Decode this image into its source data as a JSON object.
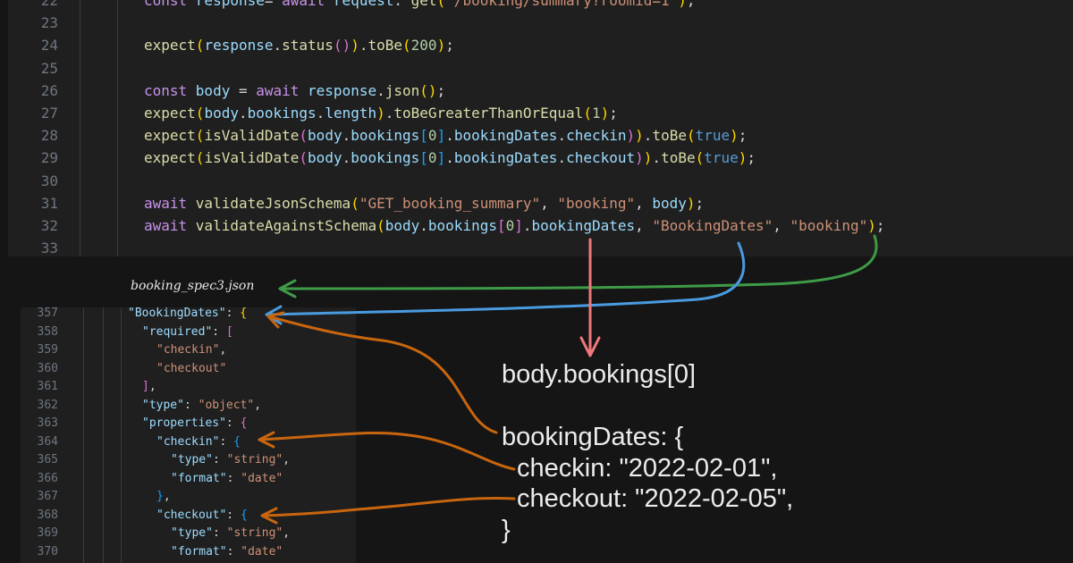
{
  "editor": {
    "lines": [
      {
        "n": "22",
        "tokens": [
          [
            "kw",
            "const "
          ],
          [
            "var",
            "response"
          ],
          [
            "",
            "= "
          ],
          [
            "kw",
            "await "
          ],
          [
            "var",
            "request"
          ],
          [
            "",
            ". "
          ],
          [
            "fn",
            "get"
          ],
          [
            "br1",
            "("
          ],
          [
            "str",
            "'/booking/summary?roomid=1'"
          ],
          [
            "br1",
            ")"
          ],
          [
            "",
            ";"
          ]
        ]
      },
      {
        "n": "23",
        "tokens": []
      },
      {
        "n": "24",
        "tokens": [
          [
            "fn",
            "expect"
          ],
          [
            "br1",
            "("
          ],
          [
            "var",
            "response"
          ],
          [
            "",
            "."
          ],
          [
            "fn",
            "status"
          ],
          [
            "br2",
            "()"
          ],
          [
            "br1",
            ")"
          ],
          [
            "",
            "."
          ],
          [
            "fn",
            "toBe"
          ],
          [
            "br1",
            "("
          ],
          [
            "num",
            "200"
          ],
          [
            "br1",
            ")"
          ],
          [
            "",
            ";"
          ]
        ]
      },
      {
        "n": "25",
        "tokens": []
      },
      {
        "n": "26",
        "tokens": [
          [
            "kw",
            "const "
          ],
          [
            "var",
            "body"
          ],
          [
            "",
            " = "
          ],
          [
            "kw",
            "await "
          ],
          [
            "var",
            "response"
          ],
          [
            "",
            "."
          ],
          [
            "fn",
            "json"
          ],
          [
            "br1",
            "()"
          ],
          [
            "",
            ";"
          ]
        ]
      },
      {
        "n": "27",
        "tokens": [
          [
            "fn",
            "expect"
          ],
          [
            "br1",
            "("
          ],
          [
            "var",
            "body"
          ],
          [
            "",
            "."
          ],
          [
            "var",
            "bookings"
          ],
          [
            "",
            "."
          ],
          [
            "var",
            "length"
          ],
          [
            "br1",
            ")"
          ],
          [
            "",
            "."
          ],
          [
            "fn",
            "toBeGreaterThanOrEqual"
          ],
          [
            "br1",
            "("
          ],
          [
            "num",
            "1"
          ],
          [
            "br1",
            ")"
          ],
          [
            "",
            ";"
          ]
        ]
      },
      {
        "n": "28",
        "tokens": [
          [
            "fn",
            "expect"
          ],
          [
            "br1",
            "("
          ],
          [
            "fn",
            "isValidDate"
          ],
          [
            "br2",
            "("
          ],
          [
            "var",
            "body"
          ],
          [
            "",
            "."
          ],
          [
            "var",
            "bookings"
          ],
          [
            "br3",
            "["
          ],
          [
            "num",
            "0"
          ],
          [
            "br3",
            "]"
          ],
          [
            "",
            "."
          ],
          [
            "var",
            "bookingDates"
          ],
          [
            "",
            "."
          ],
          [
            "var",
            "checkin"
          ],
          [
            "br2",
            ")"
          ],
          [
            "br1",
            ")"
          ],
          [
            "",
            "."
          ],
          [
            "fn",
            "toBe"
          ],
          [
            "br1",
            "("
          ],
          [
            "bool",
            "true"
          ],
          [
            "br1",
            ")"
          ],
          [
            "",
            ";"
          ]
        ]
      },
      {
        "n": "29",
        "tokens": [
          [
            "fn",
            "expect"
          ],
          [
            "br1",
            "("
          ],
          [
            "fn",
            "isValidDate"
          ],
          [
            "br2",
            "("
          ],
          [
            "var",
            "body"
          ],
          [
            "",
            "."
          ],
          [
            "var",
            "bookings"
          ],
          [
            "br3",
            "["
          ],
          [
            "num",
            "0"
          ],
          [
            "br3",
            "]"
          ],
          [
            "",
            "."
          ],
          [
            "var",
            "bookingDates"
          ],
          [
            "",
            "."
          ],
          [
            "var",
            "checkout"
          ],
          [
            "br2",
            ")"
          ],
          [
            "br1",
            ")"
          ],
          [
            "",
            "."
          ],
          [
            "fn",
            "toBe"
          ],
          [
            "br1",
            "("
          ],
          [
            "bool",
            "true"
          ],
          [
            "br1",
            ")"
          ],
          [
            "",
            ";"
          ]
        ]
      },
      {
        "n": "30",
        "tokens": []
      },
      {
        "n": "31",
        "tokens": [
          [
            "kw",
            "await "
          ],
          [
            "fn",
            "validateJsonSchema"
          ],
          [
            "br1",
            "("
          ],
          [
            "str",
            "\"GET_booking_summary\""
          ],
          [
            "",
            ", "
          ],
          [
            "str",
            "\"booking\""
          ],
          [
            "",
            ", "
          ],
          [
            "var",
            "body"
          ],
          [
            "br1",
            ")"
          ],
          [
            "",
            ";"
          ]
        ]
      },
      {
        "n": "32",
        "tokens": [
          [
            "kw",
            "await "
          ],
          [
            "fn",
            "validateAgainstSchema"
          ],
          [
            "br1",
            "("
          ],
          [
            "var",
            "body"
          ],
          [
            "",
            "."
          ],
          [
            "var",
            "bookings"
          ],
          [
            "br2",
            "["
          ],
          [
            "num",
            "0"
          ],
          [
            "br2",
            "]"
          ],
          [
            "",
            "."
          ],
          [
            "var",
            "bookingDates"
          ],
          [
            "",
            ", "
          ],
          [
            "str",
            "\"BookingDates\""
          ],
          [
            "",
            ", "
          ],
          [
            "str",
            "\"booking\""
          ],
          [
            "br1",
            ")"
          ],
          [
            "",
            ";"
          ]
        ]
      },
      {
        "n": "33",
        "tokens": []
      }
    ]
  },
  "json_file_label": "booking_spec3.json",
  "json_editor": {
    "lines": [
      {
        "n": "357",
        "indent": 0,
        "tokens": [
          [
            "jkey",
            "\"BookingDates\""
          ],
          [
            "",
            ": "
          ],
          [
            "br1",
            "{"
          ]
        ]
      },
      {
        "n": "358",
        "indent": 1,
        "tokens": [
          [
            "jkey",
            "\"required\""
          ],
          [
            "",
            ": "
          ],
          [
            "br2",
            "["
          ]
        ]
      },
      {
        "n": "359",
        "indent": 2,
        "tokens": [
          [
            "jstr",
            "\"checkin\""
          ],
          [
            "",
            ","
          ]
        ]
      },
      {
        "n": "360",
        "indent": 2,
        "tokens": [
          [
            "jstr",
            "\"checkout\""
          ]
        ]
      },
      {
        "n": "361",
        "indent": 1,
        "tokens": [
          [
            "br2",
            "]"
          ],
          [
            "",
            ","
          ]
        ]
      },
      {
        "n": "362",
        "indent": 1,
        "tokens": [
          [
            "jkey",
            "\"type\""
          ],
          [
            "",
            ": "
          ],
          [
            "jstr",
            "\"object\""
          ],
          [
            "",
            ","
          ]
        ]
      },
      {
        "n": "363",
        "indent": 1,
        "tokens": [
          [
            "jkey",
            "\"properties\""
          ],
          [
            "",
            ": "
          ],
          [
            "br2",
            "{"
          ]
        ]
      },
      {
        "n": "364",
        "indent": 2,
        "tokens": [
          [
            "jkey",
            "\"checkin\""
          ],
          [
            "",
            ": "
          ],
          [
            "br3",
            "{"
          ]
        ]
      },
      {
        "n": "365",
        "indent": 3,
        "tokens": [
          [
            "jkey",
            "\"type\""
          ],
          [
            "",
            ": "
          ],
          [
            "jstr",
            "\"string\""
          ],
          [
            "",
            ","
          ]
        ]
      },
      {
        "n": "366",
        "indent": 3,
        "tokens": [
          [
            "jkey",
            "\"format\""
          ],
          [
            "",
            ": "
          ],
          [
            "jstr",
            "\"date\""
          ]
        ]
      },
      {
        "n": "367",
        "indent": 2,
        "tokens": [
          [
            "br3",
            "}"
          ],
          [
            "",
            ","
          ]
        ]
      },
      {
        "n": "368",
        "indent": 2,
        "tokens": [
          [
            "jkey",
            "\"checkout\""
          ],
          [
            "",
            ": "
          ],
          [
            "br3",
            "{"
          ]
        ]
      },
      {
        "n": "369",
        "indent": 3,
        "tokens": [
          [
            "jkey",
            "\"type\""
          ],
          [
            "",
            ": "
          ],
          [
            "jstr",
            "\"string\""
          ],
          [
            "",
            ","
          ]
        ]
      },
      {
        "n": "370",
        "indent": 3,
        "tokens": [
          [
            "jkey",
            "\"format\""
          ],
          [
            "",
            ": "
          ],
          [
            "jstr",
            "\"date\""
          ]
        ]
      }
    ]
  },
  "annotation": {
    "body_path": "body.bookings[0]",
    "booking_dates": "bookingDates: {",
    "checkin": "checkin: \"2022-02-01\",",
    "checkout": "checkout: \"2022-02-05\",",
    "close": "}"
  },
  "colors": {
    "green_arrow": "#3e9b47",
    "blue_arrow": "#4a9be0",
    "red_arrow": "#f0787c",
    "orange_arrow": "#c8650f"
  }
}
